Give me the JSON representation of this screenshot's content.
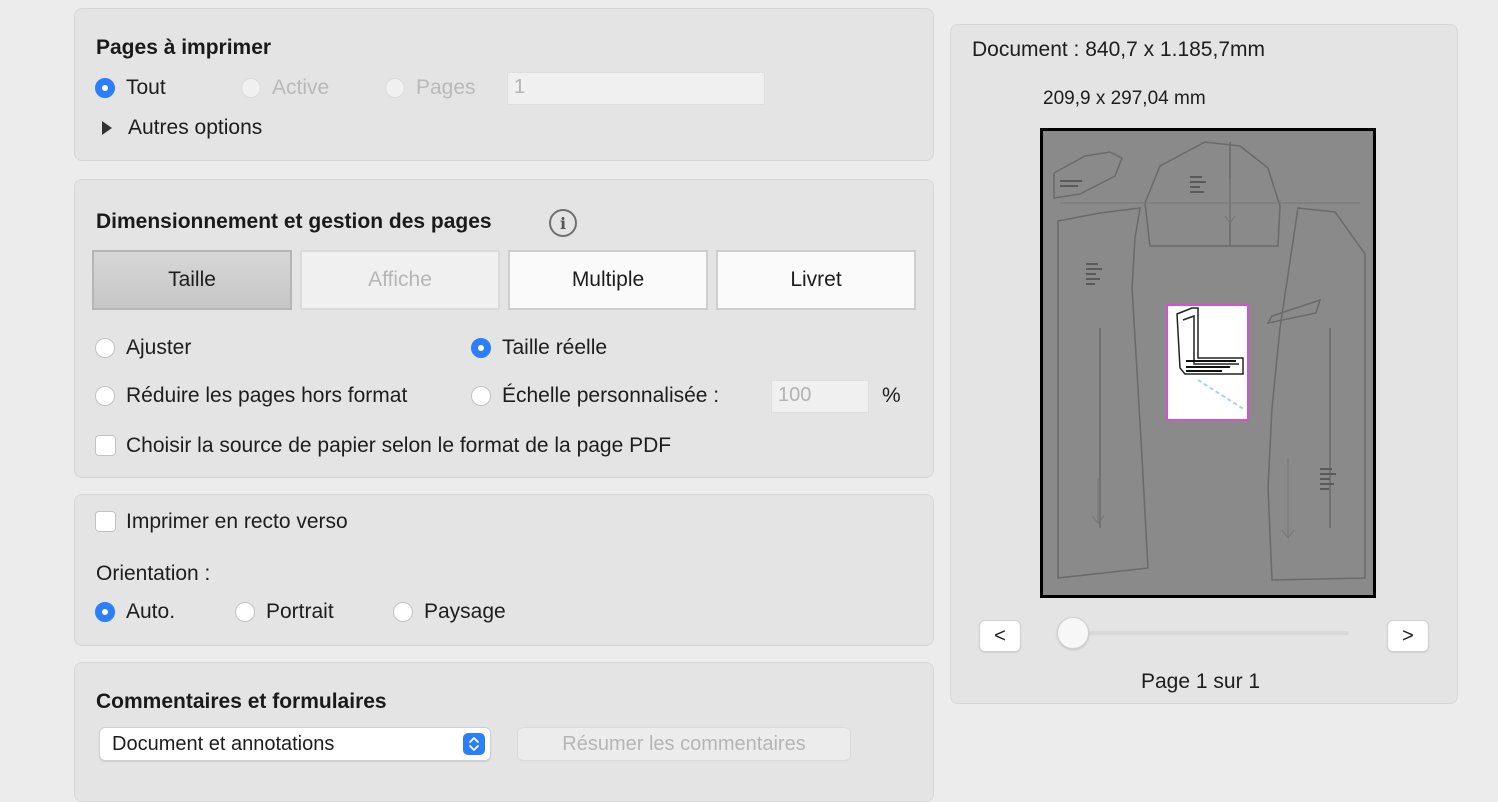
{
  "pages_section": {
    "title": "Pages à imprimer",
    "option_all": "Tout",
    "option_current": "Active",
    "option_pages": "Pages",
    "pages_value": "1",
    "more_options": "Autres options"
  },
  "sizing_section": {
    "title": "Dimensionnement et gestion des pages",
    "modes": [
      "Taille",
      "Affiche",
      "Multiple",
      "Livret"
    ],
    "fit": "Ajuster",
    "actual_size": "Taille réelle",
    "shrink": "Réduire les pages hors format",
    "custom_scale": "Échelle personnalisée :",
    "scale_value": "100",
    "percent": "%",
    "paper_source": "Choisir la source de papier selon le format de la page PDF"
  },
  "duplex_section": {
    "duplex": "Imprimer en recto verso",
    "orientation_label": "Orientation :",
    "auto": "Auto.",
    "portrait": "Portrait",
    "landscape": "Paysage"
  },
  "comments_section": {
    "title": "Commentaires et formulaires",
    "select_value": "Document et annotations",
    "summarize": "Résumer les commentaires"
  },
  "preview": {
    "doc_size": "Document : 840,7 x 1.185,7mm",
    "page_size": "209,9 x 297,04 mm",
    "prev": "<",
    "next": ">",
    "page_indicator": "Page 1 sur 1",
    "slider_position": 0
  }
}
